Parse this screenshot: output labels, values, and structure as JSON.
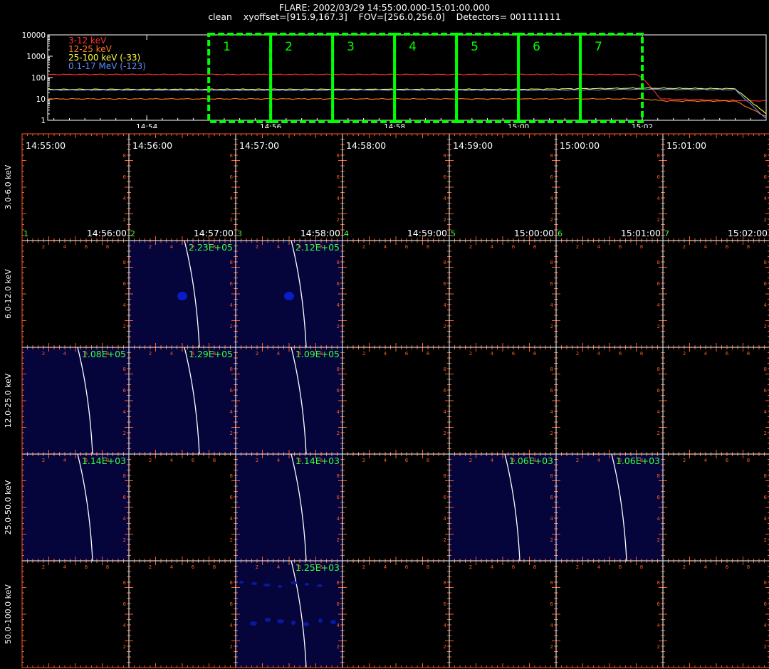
{
  "header": {
    "line1": "FLARE: 2002/03/29 14:55:00.000-15:01:00.000",
    "line2": "clean    xyoffset=[915.9,167.3]    FOV=[256.0,256.0]    Detectors= 001111111"
  },
  "colors": {
    "axis": "#ff5a1e",
    "grid_line": "#ffffff",
    "interval_box": "#00ff00",
    "image_bg": "#05053c",
    "label_green": "#3cff3c"
  },
  "chart_data": [
    {
      "type": "line",
      "name": "lightcurve",
      "y_scale": "log",
      "ylim": [
        1,
        10000
      ],
      "y_ticks": [
        "10000",
        "1000",
        "100",
        "10",
        "1"
      ],
      "x_ticks": [
        "14:54",
        "14:56",
        "14:58",
        "15:00",
        "15:02"
      ],
      "x_tick_minutes": [
        -1,
        1,
        3,
        5,
        7
      ],
      "xlim_minutes": [
        -2.6,
        9.0
      ],
      "interval_labels": [
        "1",
        "2",
        "3",
        "4",
        "5",
        "6",
        "7"
      ],
      "interval_start_minutes": [
        0,
        1,
        2,
        3,
        4,
        5,
        6
      ],
      "series": [
        {
          "name": "3-12 keV",
          "color": "#ff3030",
          "x": [
            -2.6,
            6.9,
            7.0,
            7.3,
            9.0
          ],
          "y": [
            140,
            140,
            100,
            10,
            8
          ]
        },
        {
          "name": "12-25 keV",
          "color": "#ff7a20",
          "x": [
            -2.6,
            1.0,
            3.0,
            5.0,
            7.0,
            7.4,
            8.5,
            9.0
          ],
          "y": [
            10,
            10,
            10,
            10,
            10,
            8,
            8,
            1.5
          ]
        },
        {
          "name": "25-100 keV (-33)",
          "color": "#ffff40",
          "x": [
            -2.6,
            1.0,
            3.0,
            5.0,
            7.0,
            8.5,
            9.0
          ],
          "y": [
            28,
            28,
            28,
            28,
            32,
            30,
            2
          ]
        },
        {
          "name": "0.1-17 MeV (-123)",
          "color": "#5a8cff",
          "x": [
            -2.6,
            1.0,
            3.0,
            5.0,
            7.0,
            8.5,
            9.0
          ],
          "y": [
            26,
            25,
            26,
            25,
            28,
            27,
            1.2
          ]
        }
      ]
    },
    {
      "type": "heatmap",
      "name": "image-grid",
      "rows": [
        "3.0-6.0 keV",
        "6.0-12.0 keV",
        "12.0-25.0 keV",
        "25.0-50.0 keV",
        "50.0-100.0 keV"
      ],
      "columns": [
        "1",
        "2",
        "3",
        "4",
        "5",
        "6",
        "7"
      ],
      "column_start_times": [
        "14:55:00",
        "14:56:00",
        "14:57:00",
        "14:58:00",
        "14:59:00",
        "15:00:00",
        "15:01:00"
      ],
      "column_end_times": [
        "14:56:00",
        "14:57:00",
        "14:58:00",
        "14:59:00",
        "15:00:00",
        "15:01:00",
        "15:02:00"
      ],
      "axis_tick_labels": [
        "2",
        "4",
        "6",
        "8"
      ],
      "images": [
        {
          "row": 1,
          "col": 1,
          "peak": "2.23E+05",
          "source": true
        },
        {
          "row": 1,
          "col": 2,
          "peak": "2.12E+05",
          "source": true
        },
        {
          "row": 2,
          "col": 0,
          "peak": "1.08E+05"
        },
        {
          "row": 2,
          "col": 1,
          "peak": "1.29E+05"
        },
        {
          "row": 2,
          "col": 2,
          "peak": "1.09E+05"
        },
        {
          "row": 3,
          "col": 0,
          "peak": "1.14E+03"
        },
        {
          "row": 3,
          "col": 2,
          "peak": "1.14E+03"
        },
        {
          "row": 3,
          "col": 4,
          "peak": "1.06E+03"
        },
        {
          "row": 3,
          "col": 5,
          "peak": "1.06E+03"
        },
        {
          "row": 4,
          "col": 2,
          "peak": "1.25E+03",
          "noisy": true
        }
      ]
    }
  ]
}
